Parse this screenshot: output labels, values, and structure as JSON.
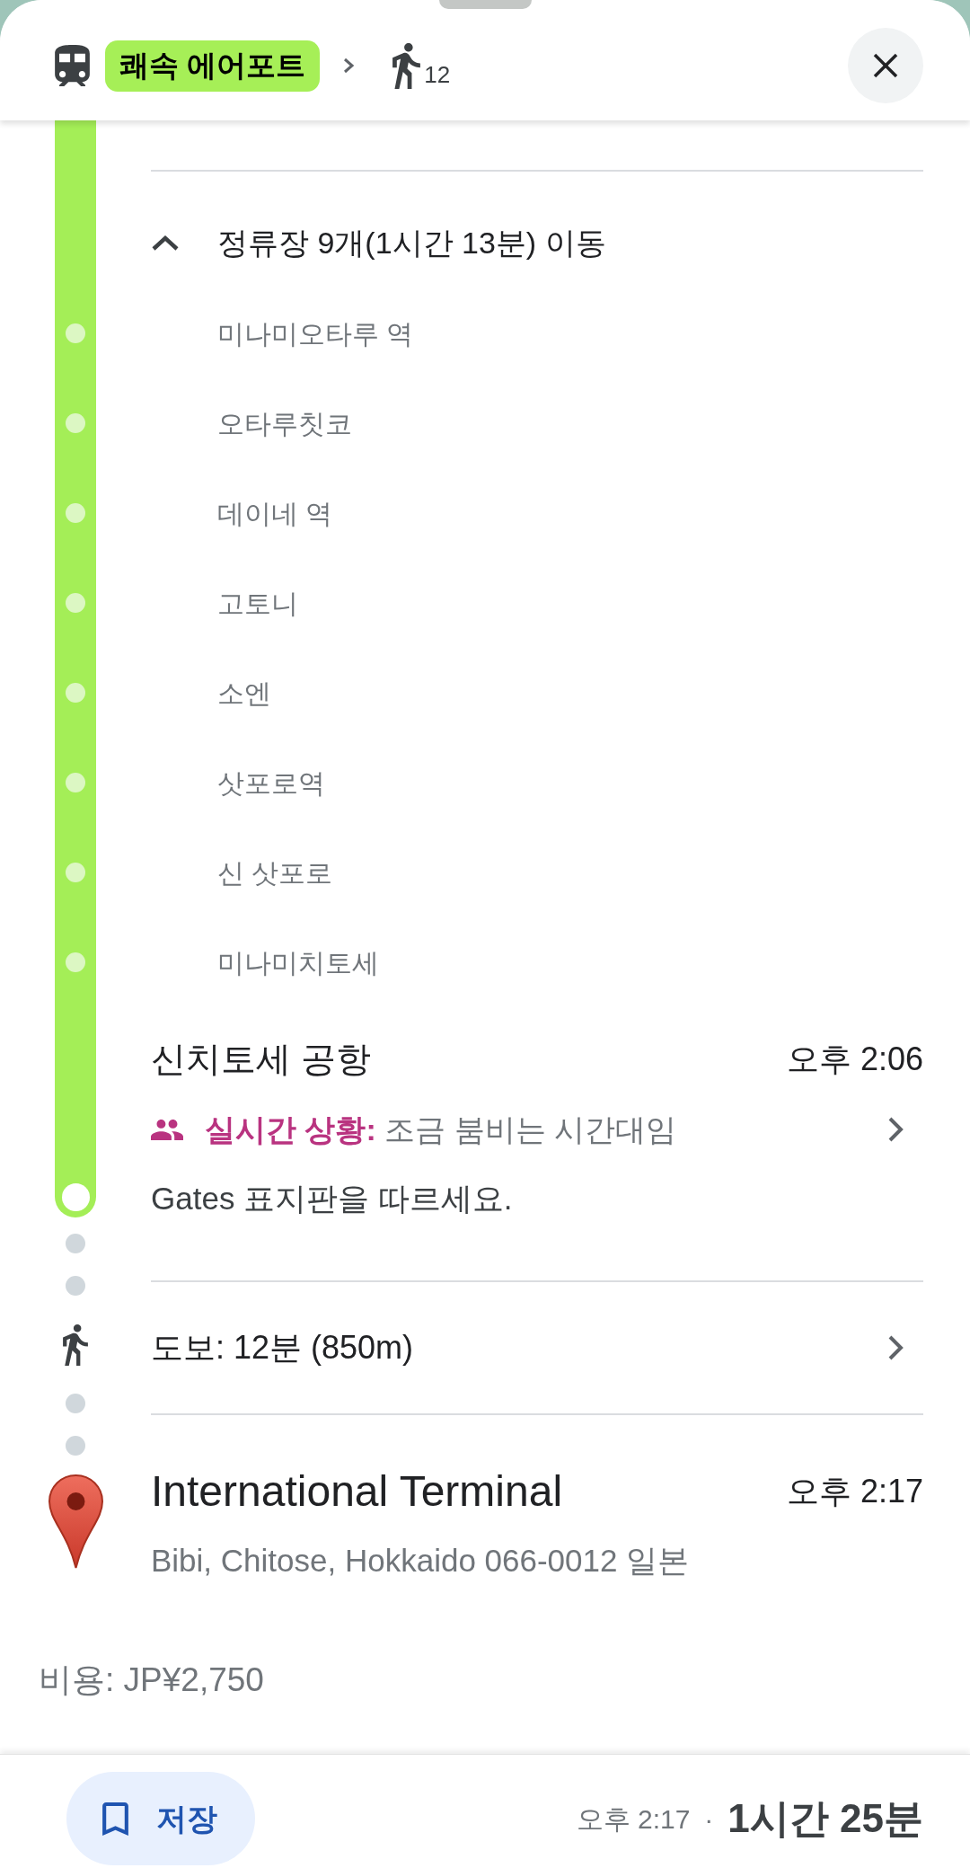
{
  "header": {
    "line_badge": "쾌속 에어포트",
    "walk_minutes": "12"
  },
  "stops_toggle": {
    "label": "정류장 9개(1시간 13분) 이동",
    "expanded": true
  },
  "stops": [
    "미나미오타루 역",
    "오타루칫코",
    "데이네 역",
    "고토니",
    "소엔",
    "삿포로역",
    "신 삿포로",
    "미나미치토세"
  ],
  "arrival": {
    "name": "신치토세 공항",
    "time": "오후 2:06",
    "crowding": "**실시간 상황:** 조금 붐비는 시간대임",
    "instruction": "Gates 표지판을 따르세요."
  },
  "walk": {
    "text": "도보: 12분 (850m)"
  },
  "destination": {
    "name": "International Terminal",
    "time": "오후 2:17",
    "address": "Bibi, Chitose, Hokkaido 066-0012 일본"
  },
  "fare": "비용: JP¥2,750",
  "bottom_bar": {
    "save_label": "저장",
    "arrival_time": "오후 2:17",
    "separator": "·",
    "duration": "1시간 25분"
  }
}
